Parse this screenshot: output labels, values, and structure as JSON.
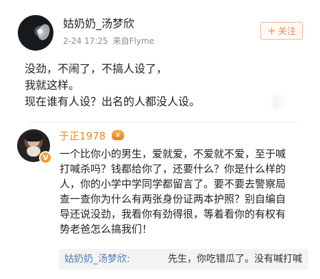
{
  "post": {
    "username": "姑奶奶_汤梦欣",
    "date_time": "2-24 17:25",
    "source": "来自Flyme",
    "follow_label": "关注",
    "lines": [
      "没劲，不闹了，不搞人设了，",
      "我就这样。",
      "现在谁有人设？出名的人都没人设。"
    ]
  },
  "comment": {
    "username": "于正1978",
    "lines": [
      "一个比你小的男生，爱就爱，不爱就不爱，至于喊",
      "打喊杀吗？钱都给你了，还要什么？你是什么样的",
      "人，你的小学中学同学都留言了。要不要去警察局",
      "查一查你为什么有两张身份证两本护照？别自编自",
      "导还说没劲，我看你有劲得很，等着看你的有权有",
      "势老爸怎么搞我们！"
    ],
    "reply": {
      "username": "姑奶奶_汤梦欣:",
      "text": "先生，你吃错瓜了。没有喊打喊"
    }
  },
  "icons": {
    "follow": "plus-icon",
    "verified": "verified-v-icon",
    "vip": "vip-crown-icon"
  },
  "colors": {
    "orange_accent": "#f08a4b",
    "link_blue": "#4f7db2",
    "meta_gray": "#8a8a8a"
  }
}
